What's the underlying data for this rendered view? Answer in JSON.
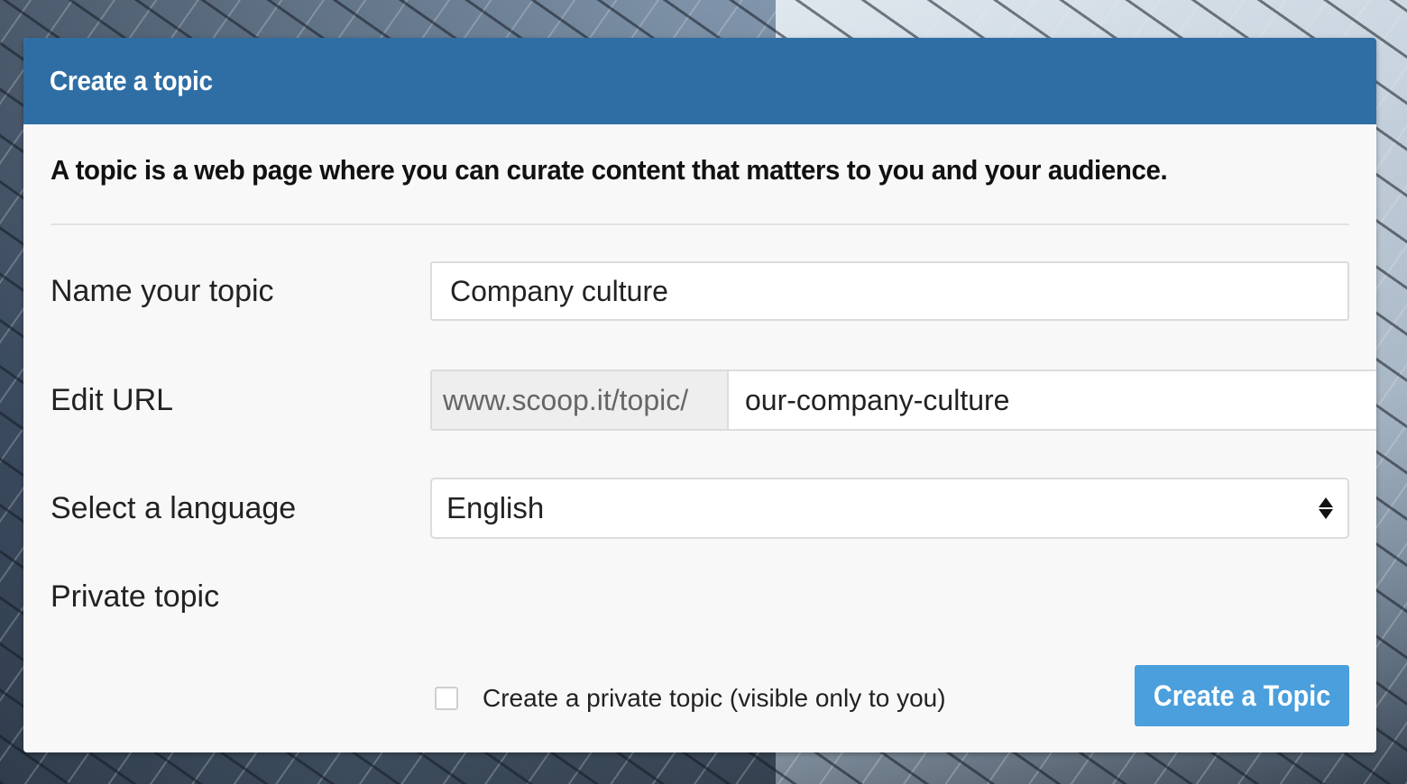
{
  "dialog": {
    "title": "Create a topic",
    "intro": "A topic is a web page where you can curate content that matters to you and your audience."
  },
  "form": {
    "name": {
      "label": "Name your topic",
      "value": "Company culture"
    },
    "url": {
      "label": "Edit URL",
      "prefix": "www.scoop.it/topic/",
      "value": "our-company-culture"
    },
    "language": {
      "label": "Select a language",
      "selected": "English"
    },
    "private": {
      "label": "Private topic",
      "checkbox_label": "Create a private topic (visible only to you)",
      "checked": false
    },
    "submit_label": "Create a Topic"
  },
  "colors": {
    "header": "#2f6ea4",
    "button": "#4a9fdc",
    "panel": "#f8f8f8"
  },
  "icons": [
    "select-arrows-icon",
    "checkbox"
  ]
}
